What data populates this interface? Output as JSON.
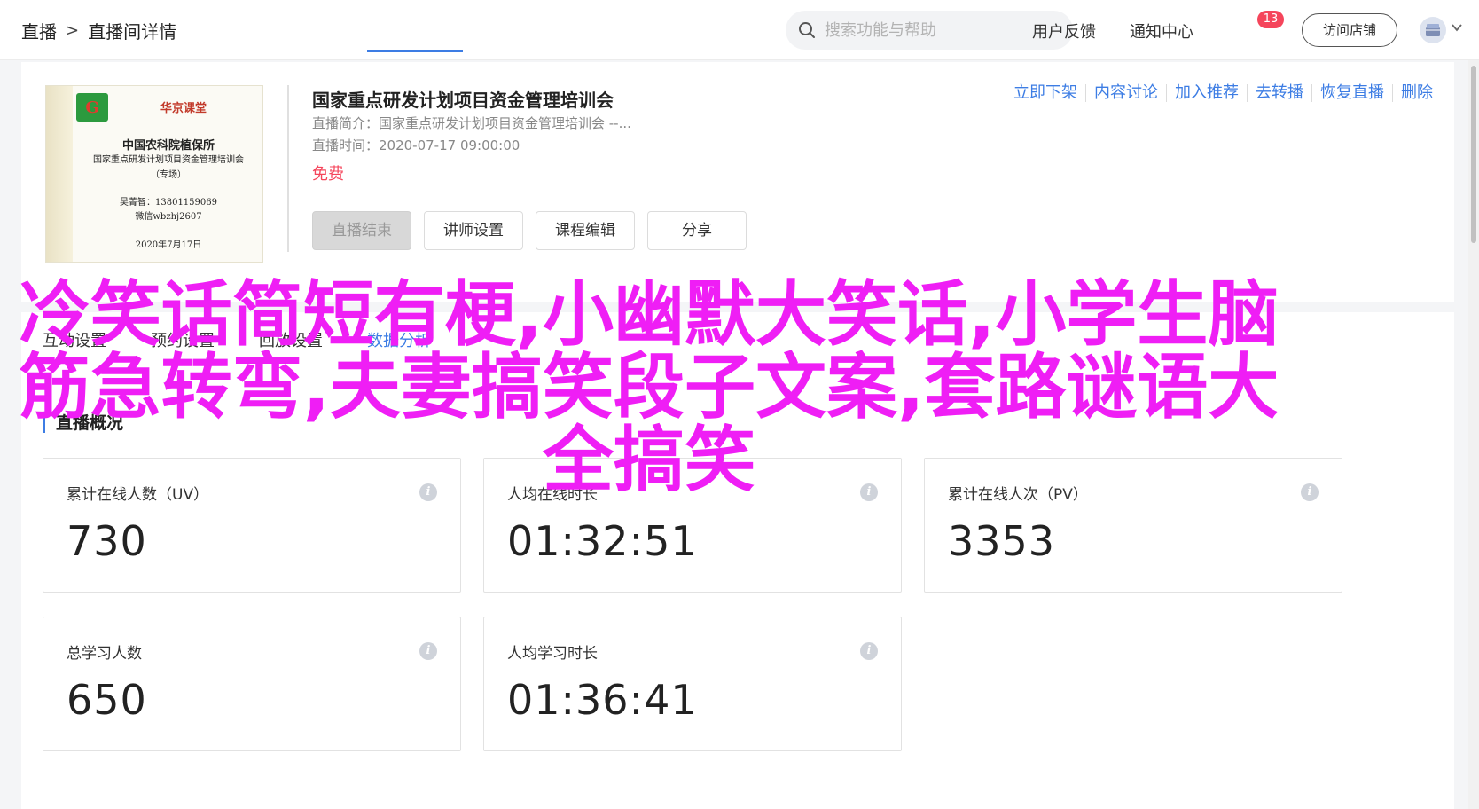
{
  "header": {
    "breadcrumb": [
      "直播",
      "直播间详情"
    ],
    "breadcrumb_sep": ">",
    "search_placeholder": "搜索功能与帮助",
    "feedback": "用户反馈",
    "notifications": "通知中心",
    "notification_count": "13",
    "visit_store": "访问店铺"
  },
  "course": {
    "title": "国家重点研发计划项目资金管理培训会",
    "intro": "直播简介：国家重点研发计划项目资金管理培训会 --...",
    "time": "直播时间：2020-07-17 09:00:00",
    "price": "免费",
    "actions": [
      "立即下架",
      "内容讨论",
      "加入推荐",
      "去转播",
      "恢复直播",
      "删除"
    ],
    "buttons": [
      "直播结束",
      "讲师设置",
      "课程编辑",
      "分享"
    ],
    "cover": {
      "logo_letter": "G",
      "brand": "华京课堂",
      "org": "中国农科院植保所",
      "subject": "国家重点研发计划项目资金管理培训会",
      "type": "（专场）",
      "contact": "吴菁智：13801159069",
      "wechat": "微信wbzhj2607",
      "date": "2020年7月17日"
    }
  },
  "tabs": [
    "互动设置",
    "预约设置",
    "回放设置",
    "数据分析"
  ],
  "overview": {
    "title": "直播概况",
    "stats": [
      {
        "label": "累计在线人数（UV）",
        "value": "730"
      },
      {
        "label": "人均在线时长",
        "value": "01:32:51"
      },
      {
        "label": "累计在线人次（PV）",
        "value": "3353"
      },
      {
        "label": "总学习人数",
        "value": "650"
      },
      {
        "label": "人均学习时长",
        "value": "01:36:41"
      }
    ]
  },
  "overlay_text": "冷笑话简短有梗,小幽默大笑话,小学生脑筋急转弯,夫妻搞笑段子文案,套路谜语大全搞笑",
  "colors": {
    "accent": "#3d7de4",
    "price": "#f5455b",
    "overlay": "#ef1ef5",
    "badge": "#f5455b"
  }
}
